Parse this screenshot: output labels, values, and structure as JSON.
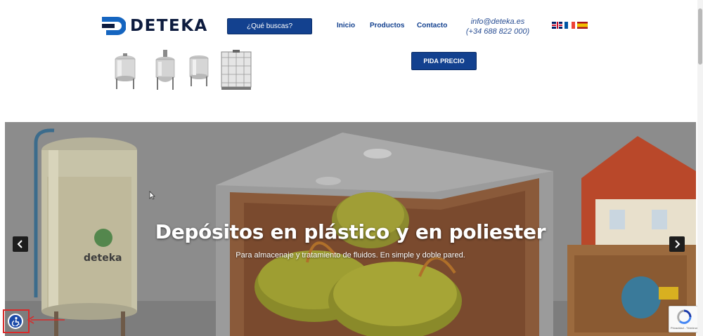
{
  "header": {
    "logo_text": "DETEKA",
    "search_label": "¿Qué buscas?",
    "nav": {
      "inicio": "Inicio",
      "productos": "Productos",
      "contacto": "Contacto"
    },
    "email": "info@deteka.es",
    "phone": "(+34 688 822 000)",
    "languages": [
      "English",
      "Français",
      "Español"
    ]
  },
  "products": {
    "cta_label": "PIDA PRECIO",
    "thumbnails": [
      "tank-on-legs",
      "mixer-tank",
      "small-tank",
      "ibc-container"
    ]
  },
  "hero": {
    "title": "Depósitos en plástico y en poliester",
    "subtitle": "Para almacenaje y tratamiento de fluidos. En simple y doble pared.",
    "tank_brand": "deteka",
    "prev_icon": "chevron-left-icon",
    "next_icon": "chevron-right-icon"
  },
  "widgets": {
    "accessibility_icon": "accessibility-icon",
    "recaptcha_label": "Privacidad - Términos"
  },
  "colors": {
    "brand_blue": "#13418f",
    "logo_dark": "#0d1b3e",
    "highlight_red": "#d92a2a"
  }
}
